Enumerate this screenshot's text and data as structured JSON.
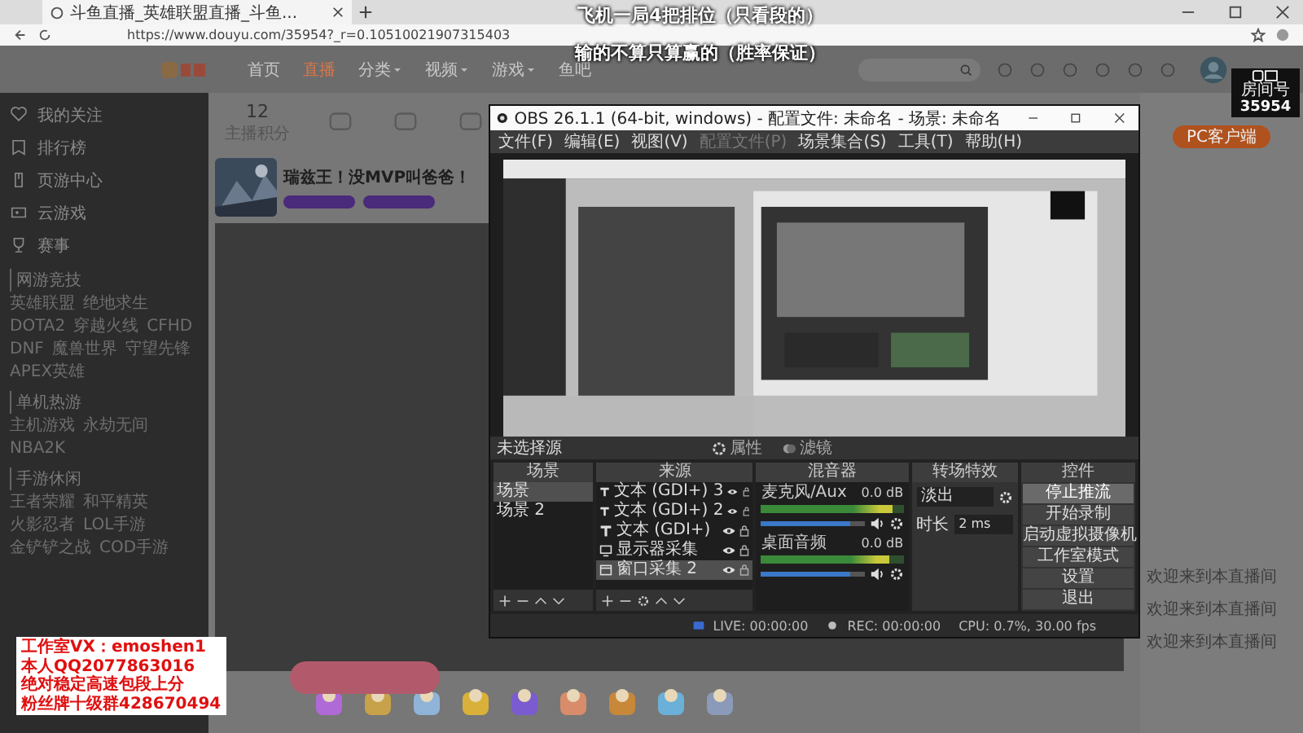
{
  "browser": {
    "tab_title": "斗鱼直播_英雄联盟直播_斗鱼...",
    "url": "https://www.douyu.com/35954?_r=0.10510021907315403"
  },
  "caption": [
    "飞机一局4把排位（只看段的）",
    "输的不算只算赢的（胜率保证）"
  ],
  "nav": [
    {
      "label": "首页",
      "selected": false,
      "dropdown": false
    },
    {
      "label": "直播",
      "selected": true,
      "dropdown": false
    },
    {
      "label": "分类",
      "selected": false,
      "dropdown": true
    },
    {
      "label": "视频",
      "selected": false,
      "dropdown": true
    },
    {
      "label": "游戏",
      "selected": false,
      "dropdown": true
    },
    {
      "label": "鱼吧",
      "selected": false,
      "dropdown": false
    }
  ],
  "room_badge": {
    "label": "房间号",
    "number": "35954"
  },
  "sidebar": {
    "items": [
      "我的关注",
      "排行榜",
      "页游中心",
      "云游戏",
      "赛事"
    ],
    "sections": [
      {
        "title": "网游竞技",
        "games": [
          "英雄联盟",
          "绝地求生",
          "DOTA2",
          "穿越火线",
          "CFHD",
          "DNF",
          "魔兽世界",
          "守望先锋",
          "APEX英雄"
        ]
      },
      {
        "title": "单机热游",
        "games": [
          "主机游戏",
          "永劫无间",
          "NBA2K"
        ]
      },
      {
        "title": "手游休闲",
        "games": [
          "王者荣耀",
          "和平精英",
          "火影忍者",
          "LOL手游",
          "金铲铲之战",
          "COD手游"
        ]
      }
    ]
  },
  "stats": {
    "score": "12",
    "score_label": "主播积分"
  },
  "stream": {
    "title": "瑞兹王！没MVP叫爸爸！"
  },
  "obs": {
    "title": "OBS 26.1.1 (64-bit, windows) - 配置文件: 未命名 - 场景: 未命名",
    "menu": [
      {
        "label": "文件(F)",
        "disabled": false
      },
      {
        "label": "编辑(E)",
        "disabled": false
      },
      {
        "label": "视图(V)",
        "disabled": false
      },
      {
        "label": "配置文件(P)",
        "disabled": true
      },
      {
        "label": "场景集合(S)",
        "disabled": false
      },
      {
        "label": "工具(T)",
        "disabled": false
      },
      {
        "label": "帮助(H)",
        "disabled": false
      }
    ],
    "source_bar": {
      "label": "未选择源",
      "properties": "属性",
      "filters": "滤镜"
    },
    "scenes": {
      "title": "场景",
      "items": [
        {
          "name": "场景",
          "selected": true
        },
        {
          "name": "场景 2",
          "selected": false
        }
      ]
    },
    "sources": {
      "title": "来源",
      "items": [
        {
          "name": "文本 (GDI+) 3",
          "kind": "text",
          "selected": false
        },
        {
          "name": "文本 (GDI+) 2",
          "kind": "text",
          "selected": false
        },
        {
          "name": "文本 (GDI+)",
          "kind": "text",
          "selected": false
        },
        {
          "name": "显示器采集",
          "kind": "display",
          "selected": false
        },
        {
          "name": "窗口采集 2",
          "kind": "window",
          "selected": true
        }
      ]
    },
    "mixer": {
      "title": "混音器",
      "channels": [
        {
          "name": "麦克风/Aux",
          "reading": "0.0 dB",
          "level": 0.93,
          "fader": {
            "level": 0.86
          }
        },
        {
          "name": "桌面音频",
          "reading": "0.0 dB",
          "level": 0.9,
          "fader": {
            "level": 0.86
          }
        }
      ]
    },
    "transitions": {
      "title": "转场特效",
      "transition": "淡出",
      "duration_label": "时长",
      "duration": "2 ms"
    },
    "controls": {
      "title": "控件",
      "buttons": [
        {
          "label": "停止推流",
          "selected": true
        },
        {
          "label": "开始录制",
          "selected": false
        },
        {
          "label": "启动虚拟摄像机",
          "selected": false
        },
        {
          "label": "工作室模式",
          "selected": false
        },
        {
          "label": "设置",
          "selected": false
        },
        {
          "label": "退出",
          "selected": false
        }
      ]
    },
    "status": {
      "live": "LIVE: 00:00:00",
      "rec": "REC: 00:00:00",
      "cpu": "CPU: 0.7%, 30.00 fps"
    }
  },
  "contact_lines": [
    "工作室VX：emoshen1",
    "本人QQ2077863016",
    "绝对稳定高速包段上分",
    "粉丝牌十级群428670494"
  ],
  "chat": {
    "client_button": "PC客户端",
    "lines": [
      "欢迎来到本直播间",
      "欢迎来到本直播间",
      "欢迎来到本直播间"
    ]
  }
}
